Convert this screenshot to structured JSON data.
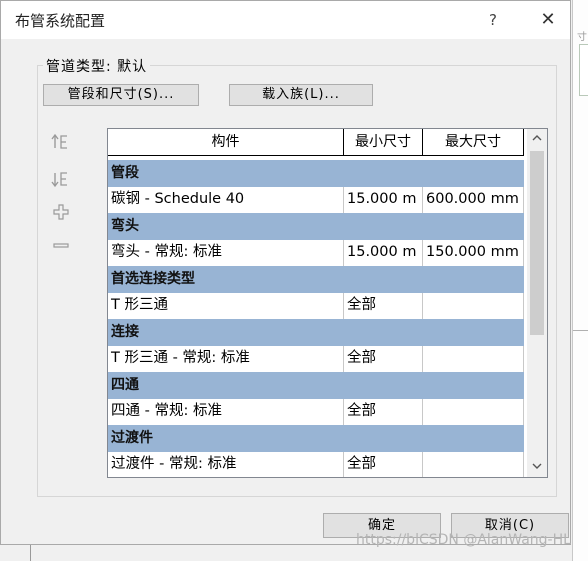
{
  "window": {
    "title": "布管系统配置",
    "help_glyph": "?",
    "close_glyph": "✕"
  },
  "pipe_type": {
    "label": "管道类型: 默认"
  },
  "buttons": {
    "segments_sizes": "管段和尺寸(S)...",
    "load_family": "载入族(L)...",
    "ok": "确定",
    "cancel": "取消(C)"
  },
  "side_toolbar": [
    {
      "name": "move-up-icon",
      "glyph": "↑E"
    },
    {
      "name": "move-down-icon",
      "glyph": "↓E"
    },
    {
      "name": "add-row-icon",
      "glyph": "+"
    },
    {
      "name": "remove-row-icon",
      "glyph": "—"
    }
  ],
  "table": {
    "columns": [
      "构件",
      "最小尺寸",
      "最大尺寸"
    ],
    "sections": [
      {
        "title": "管段",
        "row": [
          "碳钢 - Schedule 40",
          "15.000 m",
          "600.000 mm"
        ]
      },
      {
        "title": "弯头",
        "row": [
          "弯头 - 常规: 标准",
          "15.000 m",
          "150.000 mm"
        ]
      },
      {
        "title": "首选连接类型",
        "row": [
          "T 形三通",
          "全部",
          ""
        ]
      },
      {
        "title": "连接",
        "row": [
          "T 形三通 - 常规: 标准",
          "全部",
          ""
        ]
      },
      {
        "title": "四通",
        "row": [
          "四通 - 常规: 标准",
          "全部",
          ""
        ]
      },
      {
        "title": "过渡件",
        "row": [
          "过渡件 - 常规: 标准",
          "全部",
          ""
        ]
      }
    ]
  },
  "watermark": "https://blCSDN @AlanWang-HL",
  "background_fragment": "寸"
}
